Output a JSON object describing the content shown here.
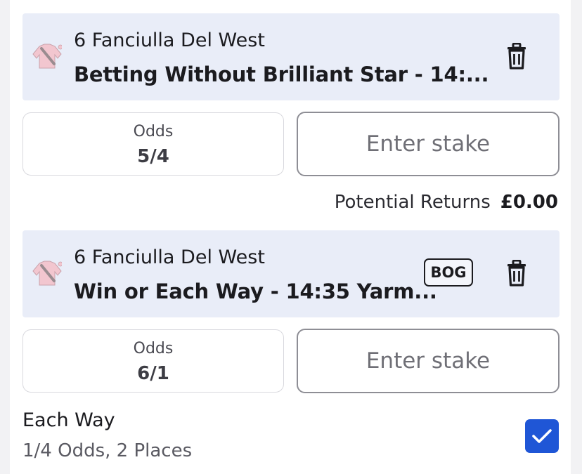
{
  "selections": [
    {
      "runner": "6 Fanciulla Del West",
      "market": "Betting Without Brilliant Star - 14:...",
      "odds_label": "Odds",
      "odds_value": "5/4",
      "stake_placeholder": "Enter stake",
      "icons": {
        "silks": "jockey-silks-icon",
        "delete": "trash-icon"
      }
    },
    {
      "runner": "6 Fanciulla Del West",
      "market": "Win or Each Way - 14:35 Yarm...",
      "badge": "BOG",
      "odds_label": "Odds",
      "odds_value": "6/1",
      "stake_placeholder": "Enter stake",
      "icons": {
        "silks": "jockey-silks-icon",
        "delete": "trash-icon"
      }
    }
  ],
  "potential_returns": {
    "label": "Potential Returns",
    "value": "£0.00"
  },
  "each_way": {
    "title": "Each Way",
    "terms": "1/4 Odds, 2 Places",
    "checked": true
  },
  "colors": {
    "header_bg": "#e9edf8",
    "checkbox_blue": "#1f56d6",
    "silks_pink": "#f2c6cf"
  }
}
